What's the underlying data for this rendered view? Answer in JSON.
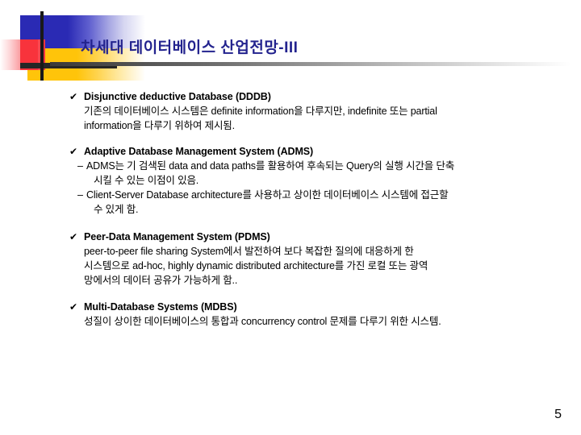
{
  "slide": {
    "title": "차세대 데이터베이스 산업전망-III",
    "page_number": "5",
    "bullet_glyph": "✔",
    "dash_glyph": "–",
    "colors": {
      "title": "#23238e",
      "ornament_blue": "#2a2ab4",
      "ornament_red": "#f8333c",
      "ornament_yellow": "#ffc40a",
      "ornament_line": "#191919",
      "rule_dark": "#3a3a3a",
      "body_text": "#000000"
    }
  },
  "sections": [
    {
      "heading": "Disjunctive deductive Database (DDDB)",
      "lines": [
        "기존의 데이터베이스 시스템은 definite information을 다루지만, indefinite 또는 partial",
        "information을 다루기 위하여 제시됨."
      ],
      "dash_items": []
    },
    {
      "heading": "Adaptive Database Management System (ADMS)",
      "lines": [],
      "dash_items": [
        {
          "lines": [
            "ADMS는 기 검색된 data and data paths를 활용하여 후속되는 Query의 실행 시간을 단축",
            "시킬 수 있는 이점이 있음."
          ]
        },
        {
          "lines": [
            "Client-Server Database architecture를 사용하고 상이한 데이터베이스 시스템에 접근할",
            "수 있게 함."
          ]
        }
      ]
    },
    {
      "heading": "Peer-Data Management System (PDMS)",
      "lines": [
        "peer-to-peer file sharing System에서 발전하여 보다 복잡한 질의에 대응하게 한",
        "시스템으로 ad-hoc, highly dynamic distributed architecture를 가진 로컬 또는 광역",
        "망에서의 데이터 공유가 가능하게 함.."
      ],
      "dash_items": []
    },
    {
      "heading": "Multi-Database Systems (MDBS)",
      "lines": [
        "성질이 상이한 데이터베이스의 통합과 concurrency control 문제를 다루기 위한 시스템."
      ],
      "dash_items": []
    }
  ]
}
